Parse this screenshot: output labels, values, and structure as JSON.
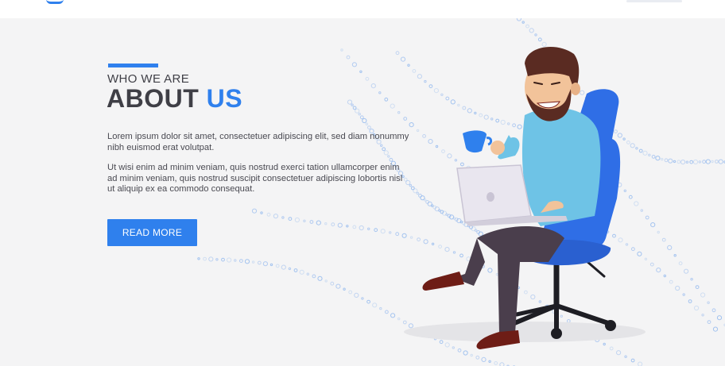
{
  "header": {
    "logo_icon": "logo-fragment",
    "nav_icon": "nav-fragment"
  },
  "about": {
    "kicker": "WHO WE ARE",
    "title_part1": "ABOUT",
    "title_part2": "US",
    "paragraph1": "Lorem ipsum dolor sit amet, consectetuer adipiscing elit, sed diam nonummy nibh euismod erat volutpat.",
    "paragraph2": "Ut wisi enim ad minim veniam, quis nostrud exerci tation ullamcorper enim ad minim veniam, quis nostrud suscipit consectetuer adipiscing  lobortis nisl ut aliquip ex ea commodo consequat.",
    "button_label": "READ MORE"
  },
  "colors": {
    "accent": "#2f80ed",
    "heading": "#3f3f46",
    "background": "#f4f4f5",
    "dots": "#8fb6ee"
  },
  "illustration": {
    "subject": "man-with-laptop-and-cup-in-office-chair-icon"
  }
}
